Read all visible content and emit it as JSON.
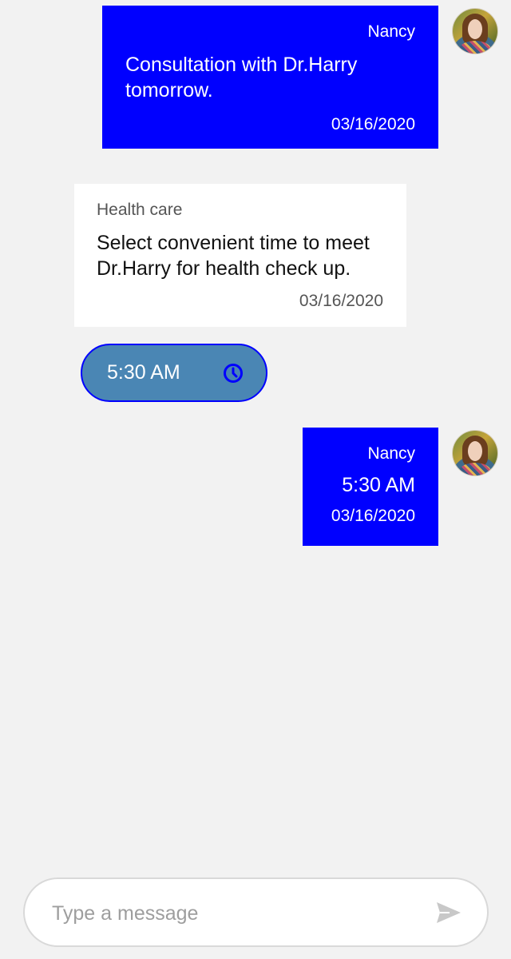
{
  "messages": [
    {
      "sender": "Nancy",
      "text": "Consultation with Dr.Harry tomorrow.",
      "date": "03/16/2020",
      "avatar_icon": "user-avatar-photo"
    },
    {
      "sender": "Health care",
      "text": "Select convenient time to meet Dr.Harry for health check up.",
      "date": "03/16/2020"
    },
    {
      "sender": "Nancy",
      "text": "5:30 AM",
      "date": "03/16/2020",
      "avatar_icon": "user-avatar-photo"
    }
  ],
  "time_picker": {
    "value": "5:30 AM",
    "icon": "clock-icon"
  },
  "composer": {
    "placeholder": "Type a message",
    "send_icon": "send-icon"
  },
  "colors": {
    "background": "#f2f2f2",
    "outgoing_bubble": "#0000ff",
    "incoming_bubble": "#ffffff",
    "time_picker_fill": "#4a86b4",
    "time_picker_border": "#0000ff",
    "send_icon": "#c8c8c8"
  }
}
